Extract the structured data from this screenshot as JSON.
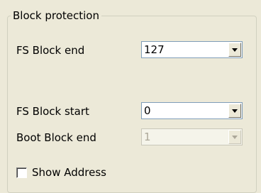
{
  "group": {
    "title": "Block protection"
  },
  "fs_block_end": {
    "label": "FS Block end",
    "value": "127"
  },
  "fs_block_start": {
    "label": "FS Block start",
    "value": "0"
  },
  "boot_block_end": {
    "label": "Boot Block end",
    "value": "1",
    "disabled": true
  },
  "show_address": {
    "label": "Show Address",
    "checked": false
  },
  "icons": {
    "dropdown": "chevron-down-icon"
  },
  "colors": {
    "background": "#ece9d8",
    "field_border": "#7f9db9",
    "disabled_text": "#aca899"
  }
}
